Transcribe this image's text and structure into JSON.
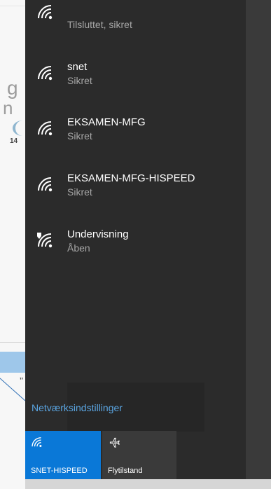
{
  "background": {
    "text_g": "g",
    "text_n": "n",
    "text_14": "14",
    "text_partial": "’’"
  },
  "networks": [
    {
      "name": "",
      "status": "Tilsluttet, sikret",
      "icon": "wifi-icon"
    },
    {
      "name": "snet",
      "status": "Sikret",
      "icon": "wifi-icon"
    },
    {
      "name": "EKSAMEN-MFG",
      "status": "Sikret",
      "icon": "wifi-icon"
    },
    {
      "name": "EKSAMEN-MFG-HISPEED",
      "status": "Sikret",
      "icon": "wifi-icon"
    },
    {
      "name": "Undervisning",
      "status": "Åben",
      "icon": "wifi-shield-icon"
    }
  ],
  "settings_link": "Netværksindstillinger",
  "tiles": [
    {
      "label": "SNET-HISPEED",
      "icon": "wifi-icon",
      "active": true
    },
    {
      "label": "Flytilstand",
      "icon": "airplane-icon",
      "active": false
    }
  ],
  "colors": {
    "flyout_bg": "#2b2b2b",
    "accent": "#0a78d7",
    "link": "#5aa4e0",
    "status_text": "#a6a6a6"
  }
}
